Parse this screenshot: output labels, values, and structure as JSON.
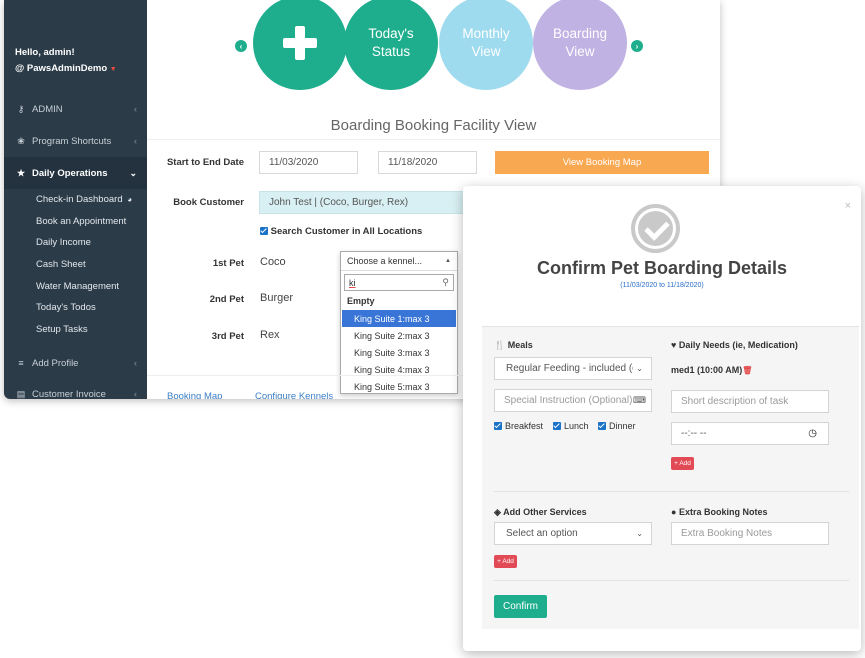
{
  "sidebar": {
    "greeting": "Hello, admin!",
    "account": "@ PawsAdminDemo",
    "items": [
      {
        "label": "ADMIN",
        "icon": "key-icon"
      },
      {
        "label": "Program Shortcuts",
        "icon": "paw-icon"
      },
      {
        "label": "Daily Operations",
        "icon": "star-icon"
      },
      {
        "label": "Add Profile",
        "icon": "database-icon"
      },
      {
        "label": "Customer Invoice",
        "icon": "invoice-icon"
      }
    ],
    "sub_items": [
      "Check-in Dashboard",
      "Book an Appointment",
      "Daily Income",
      "Cash Sheet",
      "Water Management",
      "Today's Todos",
      "Setup Tasks"
    ]
  },
  "top_nav": {
    "today_status": "Today's Status",
    "monthly_view": "Monthly View",
    "boarding_view": "Boarding View"
  },
  "page": {
    "heading": "Boarding Booking Facility View",
    "date_label": "Start to End Date",
    "start_date": "11/03/2020",
    "end_date": "11/18/2020",
    "view_map_button": "View Booking Map",
    "book_customer_label": "Book Customer",
    "customer_value": "John Test |  (Coco, Burger, Rex)",
    "search_all_label": "Search Customer in All Locations",
    "pets": [
      {
        "label": "1st Pet",
        "name": "Coco"
      },
      {
        "label": "2nd Pet",
        "name": "Burger"
      },
      {
        "label": "3rd Pet",
        "name": "Rex"
      }
    ],
    "bottom_tabs": [
      "Booking Map",
      "Configure Kennels"
    ]
  },
  "kennel_dropdown": {
    "placeholder": "Choose a kennel...",
    "search_value": "ki",
    "group": "Empty",
    "options": [
      "King Suite 1:max 3",
      "King Suite 2:max 3",
      "King Suite 3:max 3",
      "King Suite 4:max 3",
      "King Suite 5:max 3"
    ],
    "highlighted_index": 0
  },
  "modal": {
    "title": "Confirm Pet Boarding Details",
    "date_range": "(11/03/2020 to 11/18/2020)",
    "close": "×",
    "meals_label": "Meals",
    "meals_value": "Regular Feeding - included (c",
    "special_instruction_placeholder": "Special Instruction (Optional)",
    "meal_checks": [
      "Breakfest",
      "Lunch",
      "Dinner"
    ],
    "daily_needs_label": "Daily Needs (ie, Medication)",
    "medication_item": "med1 (10:00 AM)",
    "task_placeholder": "Short description of task",
    "time_placeholder": "--:-- --",
    "add_label": "+ Add",
    "other_services_label": "Add Other Services",
    "other_services_value": "Select an option",
    "notes_label": "Extra Booking Notes",
    "notes_placeholder": "Extra Booking Notes",
    "add_label_2": "+ Add",
    "confirm_button": "Confirm"
  },
  "colors": {
    "sidebar_bg": "#2c3b48",
    "green": "#1fae8d",
    "light_blue": "#9edbee",
    "lavender": "#c0b2e3",
    "orange": "#f9a852",
    "red": "#e24a55"
  }
}
